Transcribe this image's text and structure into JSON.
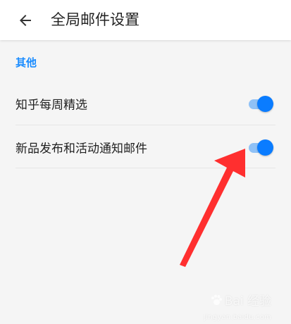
{
  "header": {
    "title": "全局邮件设置",
    "back_icon": "arrow-left-icon"
  },
  "section": {
    "title": "其他"
  },
  "settings": [
    {
      "label": "知乎每周精选",
      "enabled": true
    },
    {
      "label": "新品发布和活动通知邮件",
      "enabled": true
    }
  ],
  "colors": {
    "accent": "#0a7cff",
    "section_header": "#1a8cff",
    "arrow": "#ff2f2f",
    "background": "#f5f5f5"
  },
  "watermark": {
    "brand": "Bai 经验",
    "url": "jingyan.baidu.com"
  }
}
